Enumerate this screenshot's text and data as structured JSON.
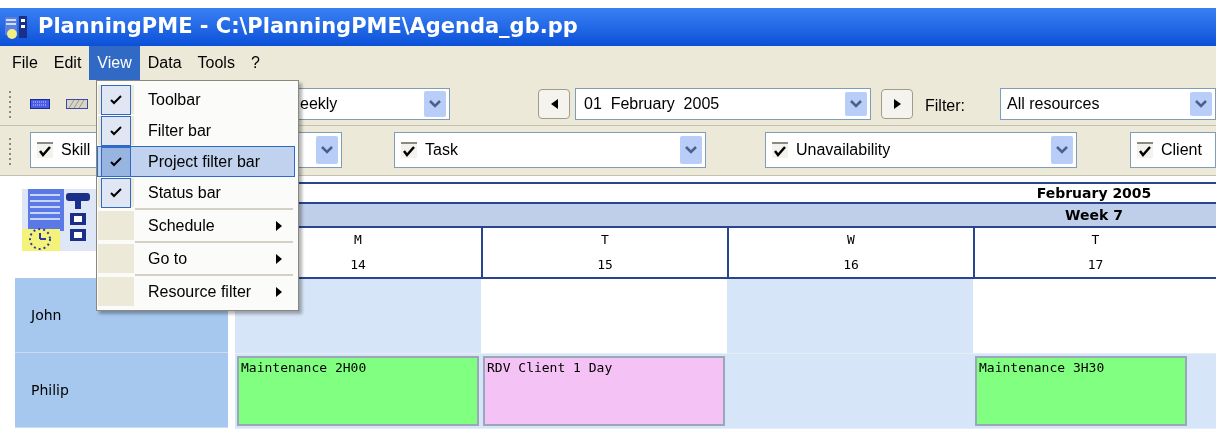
{
  "window": {
    "title": "PlanningPME - C:\\PlanningPME\\Agenda_gb.pp"
  },
  "menu_bar": [
    {
      "label": "File",
      "selected": false
    },
    {
      "label": "Edit",
      "selected": false
    },
    {
      "label": "View",
      "selected": true
    },
    {
      "label": "Data",
      "selected": false
    },
    {
      "label": "Tools",
      "selected": false
    },
    {
      "label": "?",
      "selected": false
    }
  ],
  "view_menu": [
    {
      "kind": "check",
      "label": "Toolbar",
      "checked": true,
      "selected": false
    },
    {
      "kind": "check",
      "label": "Filter bar",
      "checked": true,
      "selected": false
    },
    {
      "kind": "check",
      "label": "Project filter bar",
      "checked": true,
      "selected": true
    },
    {
      "kind": "check",
      "label": "Status bar",
      "checked": true,
      "selected": false
    },
    {
      "kind": "submenu",
      "label": "Schedule",
      "selected": false
    },
    {
      "kind": "submenu",
      "label": "Go to",
      "selected": false
    },
    {
      "kind": "submenu",
      "label": "Resource filter",
      "selected": false
    }
  ],
  "toolbar": {
    "view_combo": "eekly",
    "date_combo": "01  February  2005",
    "filter_label": "Filter:",
    "filter_combo": "All resources"
  },
  "filter_bar": [
    {
      "label": "Skill",
      "checked": true
    },
    {
      "label": "Task",
      "checked": true
    },
    {
      "label": "Unavailability",
      "checked": true
    },
    {
      "label": "Client",
      "checked": true
    }
  ],
  "calendar": {
    "month": "February 2005",
    "week": "Week 7",
    "days": [
      {
        "weekday": "M",
        "date": "14"
      },
      {
        "weekday": "T",
        "date": "15"
      },
      {
        "weekday": "W",
        "date": "16"
      },
      {
        "weekday": "T",
        "date": "17"
      }
    ],
    "resources": [
      {
        "name": "John",
        "cells": [
          {
            "shaded": true
          },
          {
            "shaded": false
          },
          {
            "shaded": true
          },
          {
            "shaded": false
          }
        ]
      },
      {
        "name": "Philip",
        "cells": [
          {
            "shaded": true,
            "event": {
              "label": "Maintenance 2H00",
              "color": "#80ff80"
            }
          },
          {
            "shaded": true,
            "event": {
              "label": "RDV Client 1 Day",
              "color": "#f5c2f5"
            }
          },
          {
            "shaded": true
          },
          {
            "shaded": true,
            "event": {
              "label": "Maintenance 3H30",
              "color": "#80ff80"
            }
          }
        ]
      }
    ]
  }
}
